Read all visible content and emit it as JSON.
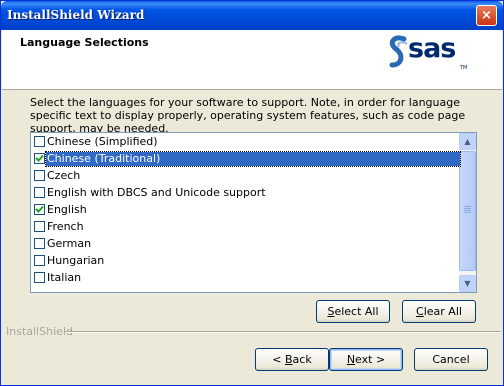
{
  "window": {
    "title": "InstallShield Wizard",
    "close_glyph": "×"
  },
  "header": {
    "title": "Language Selections",
    "logo_text": "sas",
    "logo_mark": "S",
    "logo_tm": "TM"
  },
  "instructions": "Select the languages for your software to support.  Note, in order for language specific text to display properly, operating system features, such as code page support, may be needed.",
  "languages": [
    {
      "label": "Chinese (Simplified)",
      "checked": false,
      "selected": false
    },
    {
      "label": "Chinese (Traditional)",
      "checked": true,
      "selected": true
    },
    {
      "label": "Czech",
      "checked": false,
      "selected": false
    },
    {
      "label": "English with DBCS and Unicode support",
      "checked": false,
      "selected": false
    },
    {
      "label": "English",
      "checked": true,
      "selected": false
    },
    {
      "label": "French",
      "checked": false,
      "selected": false
    },
    {
      "label": "German",
      "checked": false,
      "selected": false
    },
    {
      "label": "Hungarian",
      "checked": false,
      "selected": false
    },
    {
      "label": "Italian",
      "checked": false,
      "selected": false
    }
  ],
  "buttons": {
    "select_all": {
      "accel": "S",
      "rest": "elect All"
    },
    "clear_all": {
      "accel": "C",
      "rest": "lear All"
    },
    "back": {
      "pre": "< ",
      "accel": "B",
      "rest": "ack"
    },
    "next": {
      "accel": "N",
      "rest": "ext >"
    },
    "cancel": "Cancel"
  },
  "footer_brand": "InstallShield",
  "icons": {
    "scroll_up": "scroll-up-icon",
    "scroll_down": "scroll-down-icon",
    "check": "checkmark-icon",
    "logo": "sas-logo-icon"
  },
  "colors": {
    "selection": "#316ac5",
    "title_bar": "#0055e6",
    "logo": "#002a6c"
  }
}
